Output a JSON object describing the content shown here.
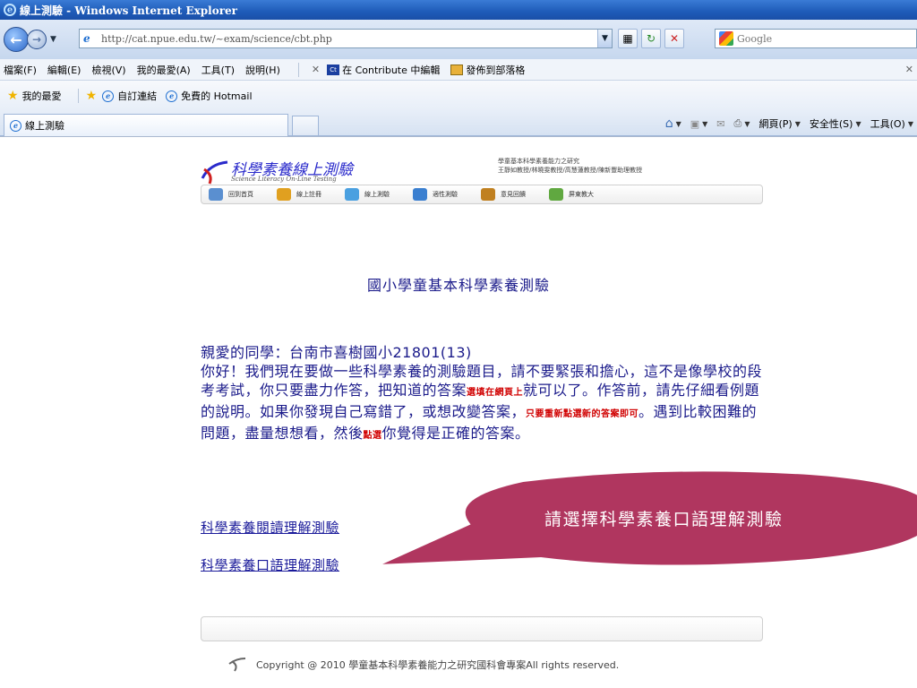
{
  "window": {
    "title": "線上測驗 - Windows Internet Explorer"
  },
  "address": {
    "url": "http://cat.npue.edu.tw/~exam/science/cbt.php",
    "search_placeholder": "Google"
  },
  "menubar": {
    "items": [
      "檔案(F)",
      "編輯(E)",
      "檢視(V)",
      "我的最愛(A)",
      "工具(T)",
      "說明(H)"
    ],
    "contribute_label": "在 Contribute 中編輯",
    "blog_label": "發佈到部落格"
  },
  "favorites": {
    "label": "我的最愛",
    "links": [
      "自訂連結",
      "免費的 Hotmail"
    ]
  },
  "tab": {
    "title": "線上測驗"
  },
  "commandbar": {
    "page": "網頁(P)",
    "safety": "安全性(S)",
    "tools": "工具(O)"
  },
  "banner": {
    "title": "科學素養線上測驗",
    "subtitle": "Science Literacy On-Line Testing",
    "credits_line1": "學童基本科學素養能力之研究",
    "credits_line2": "王靜如教授/林曉雯教授/高慧蓮教授/陳新豐助理教授",
    "nav": [
      "回到首頁",
      "線上註冊",
      "線上測驗",
      "適性測驗",
      "意見回饋",
      "屏東教大"
    ]
  },
  "content": {
    "heading": "國小學童基本科學素養測驗",
    "greeting": "親愛的同學：台南市喜樹國小21801(13)",
    "p1a": "你好！我們現在要做一些科學素養的測驗題目，請不要緊張和擔心，這不是像學校的段考考試，你只要盡力作答，把知道的答案",
    "p1_red1": "選填在網頁上",
    "p1b": "就可以了。作答前，請先仔細看例題的說明。如果你發現自己寫錯了，或想改變答案，",
    "p1_red2": "只要重新點選新的答案即可",
    "p1c": "。遇到比較困難的問題，盡量想想看，然後",
    "p1_red3": "點選",
    "p1d": "你覺得是正確的答案。",
    "link_reading": "科學素養閱讀理解測驗",
    "link_oral": "科學素養口語理解測驗"
  },
  "callout": {
    "text": "請選擇科學素養口語理解測驗",
    "fill": "#b0365f"
  },
  "footer": {
    "copyright": "Copyright @ 2010 學童基本科學素養能力之研究國科會專案All rights reserved."
  }
}
